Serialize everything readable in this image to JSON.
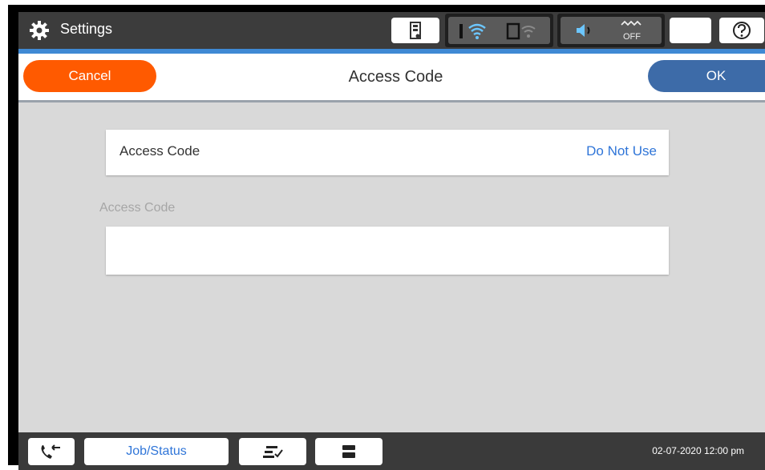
{
  "topbar": {
    "title": "Settings",
    "icons": [
      "gear-icon",
      "ink-icon",
      "wifi-icon",
      "wifi-direct-icon",
      "sound-icon",
      "fax-off-icon",
      "sleep-icon",
      "help-icon"
    ],
    "fax_status": "OFF"
  },
  "header": {
    "cancel_label": "Cancel",
    "title": "Access Code",
    "ok_label": "OK"
  },
  "settings": {
    "access_code_label": "Access Code",
    "access_code_value": "Do Not Use"
  },
  "access_code_field": {
    "label": "Access Code",
    "value": ""
  },
  "bottombar": {
    "job_status_label": "Job/Status",
    "datetime": "02-07-2020 12:00 pm",
    "icons": [
      "fax-call-icon",
      "job-queue-icon",
      "copy-icon"
    ]
  },
  "colors": {
    "cancel": "#ff5a00",
    "ok": "#3d6ba8",
    "accent": "#3f89d4",
    "link": "#2f75d8"
  }
}
